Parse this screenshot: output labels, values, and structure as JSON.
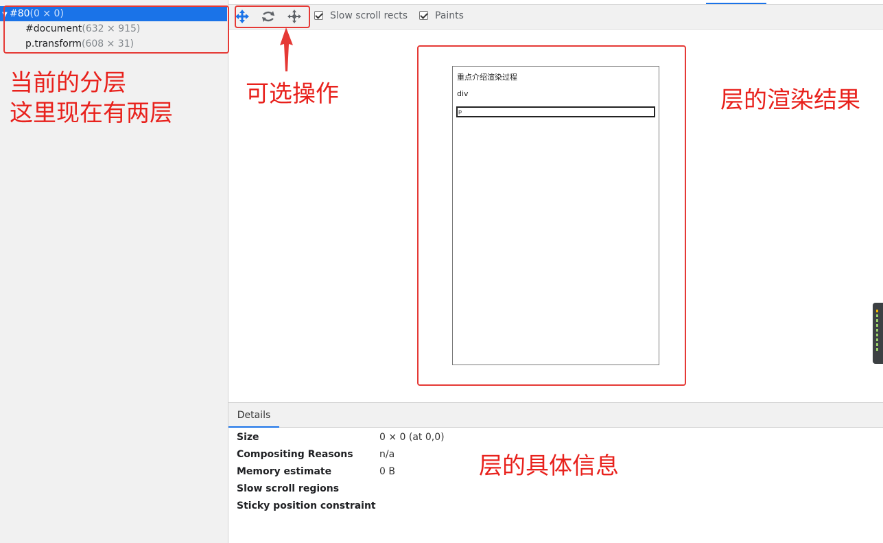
{
  "tree": {
    "root": {
      "name": "#80",
      "size": "(0 × 0)"
    },
    "children": [
      {
        "name": "#document",
        "size": "(632 × 915)"
      },
      {
        "name": "p.transform",
        "size": "(608 × 31)"
      }
    ]
  },
  "toolbar": {
    "icons": [
      "pan-mode-icon",
      "rotate-mode-icon",
      "reset-transform-icon"
    ],
    "checkboxes": [
      {
        "label": "Slow scroll rects",
        "checked": true
      },
      {
        "label": "Paints",
        "checked": true
      }
    ]
  },
  "canvas": {
    "heading": "重点介绍渲染过程",
    "div_text": "div",
    "p_text": "p"
  },
  "details": {
    "tab_label": "Details",
    "rows": [
      {
        "key": "Size",
        "value": "0 × 0 (at 0,0)"
      },
      {
        "key": "Compositing Reasons",
        "value": "n/a"
      },
      {
        "key": "Memory estimate",
        "value": "0 B"
      },
      {
        "key": "Slow scroll regions",
        "value": ""
      },
      {
        "key": "Sticky position constraint",
        "value": ""
      }
    ]
  },
  "annotations": {
    "layers_line1": "当前的分层",
    "layers_line2": "这里现在有两层",
    "operations": "可选操作",
    "render_result": "层的渲染结果",
    "details_info": "层的具体信息"
  },
  "colors": {
    "accent": "#1a73e8",
    "annotation": "#e53935"
  }
}
